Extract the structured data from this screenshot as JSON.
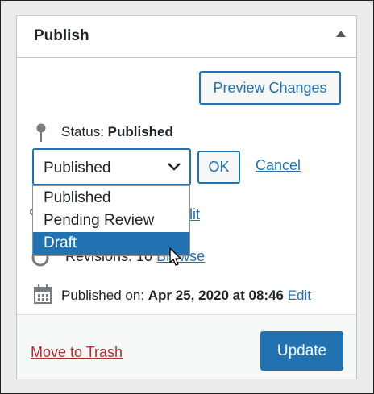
{
  "publish_box": {
    "title": "Publish",
    "preview_button": "Preview Changes",
    "status_label": "Status:",
    "status_value": "Published",
    "select_value": "Published",
    "ok_button": "OK",
    "cancel_link": "Cancel",
    "visibility_edit": "lit",
    "revisions_label": "Revisions: 10",
    "revisions_link": "Browse",
    "published_on_label": "Published on:",
    "published_on_value": "Apr 25, 2020 at 08:46",
    "published_edit": "Edit",
    "trash_link": "Move to Trash",
    "update_button": "Update"
  },
  "status_options": [
    "Published",
    "Pending Review",
    "Draft"
  ],
  "selected_option_index": 2,
  "colors": {
    "accent": "#2271b1",
    "trash": "#b32d2e",
    "text": "#1d2327"
  }
}
